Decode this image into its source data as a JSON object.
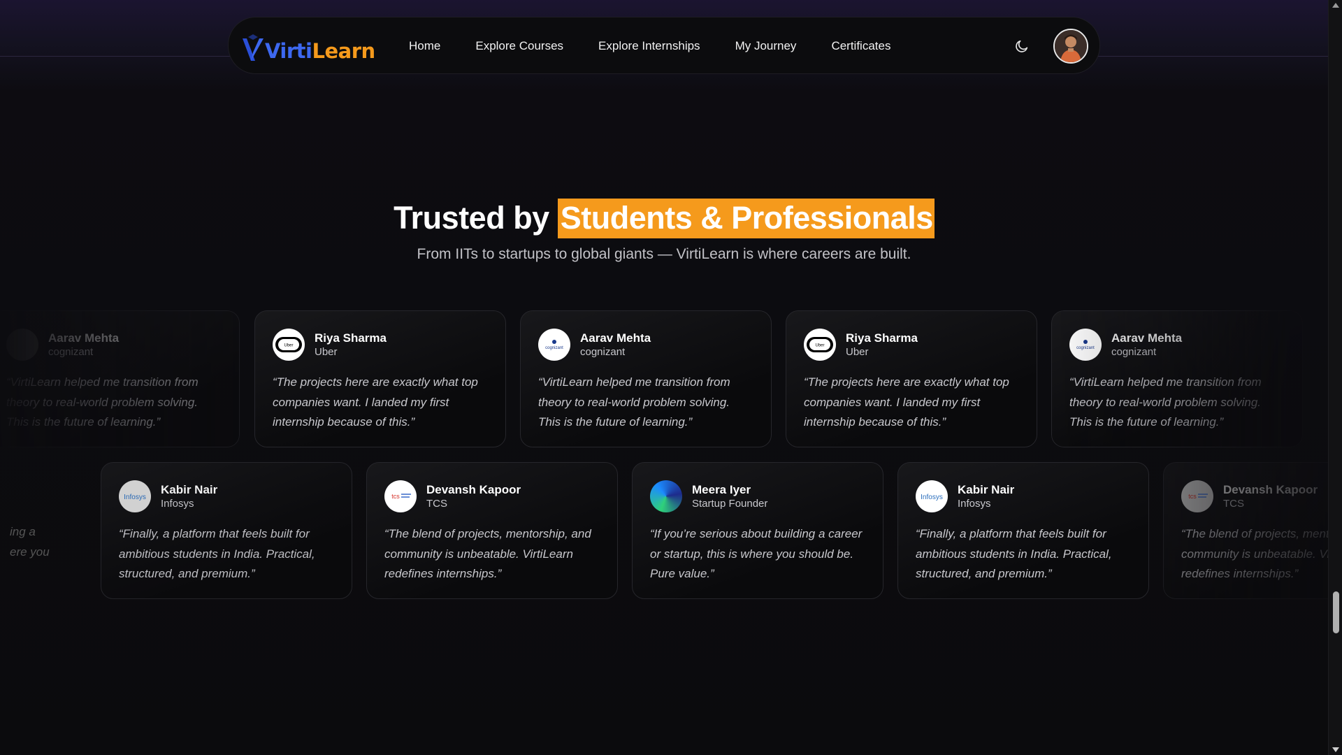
{
  "nav": {
    "logo_text_a": "Virti",
    "logo_text_b": "Learn",
    "items": [
      "Home",
      "Explore Courses",
      "Explore Internships",
      "My Journey",
      "Certificates"
    ],
    "theme_icon": "moon-icon",
    "avatar": "user-avatar"
  },
  "hero": {
    "title_plain": "Trusted by ",
    "title_highlight": "Students & Professionals",
    "subtitle": "From IITs to startups to global giants — VirtiLearn is where careers are built."
  },
  "testimonials_row1": [
    {
      "name": "Aarav Mehta",
      "company": "cognizant",
      "logo": "cognizant-logo",
      "quote": "“VirtiLearn helped me transition from theory to real-world problem solving. This is the future of learning.”"
    },
    {
      "name": "Riya Sharma",
      "company": "Uber",
      "logo": "uber-logo",
      "quote": "“The projects here are exactly what top companies want. I landed my first internship because of this.”"
    },
    {
      "name": "Aarav Mehta",
      "company": "cognizant",
      "logo": "cognizant-logo",
      "quote": "“VirtiLearn helped me transition from theory to real-world problem solving. This is the future of learning.”"
    },
    {
      "name": "Riya Sharma",
      "company": "Uber",
      "logo": "uber-logo",
      "quote": "“The projects here are exactly what top companies want. I landed my first internship because of this.”"
    },
    {
      "name": "Aarav Mehta",
      "company": "cognizant",
      "logo": "cognizant-logo",
      "quote": "“VirtiLearn helped me transition from theory to real-world problem solving. This is the future of learning.”"
    }
  ],
  "testimonials_row2": [
    {
      "name": "Kabir Nair",
      "company": "Infosys",
      "logo": "infosys-logo",
      "quote": "“Finally, a platform that feels built for ambitious students in India. Practical, structured, and premium.”"
    },
    {
      "name": "Devansh Kapoor",
      "company": "TCS",
      "logo": "tcs-logo",
      "quote": "“The blend of projects, mentorship, and community is unbeatable. VirtiLearn redefines internships.”"
    },
    {
      "name": "Meera Iyer",
      "company": "Startup Founder",
      "logo": "gradient-orb-logo",
      "quote": "“If you’re serious about building a career or startup, this is where you should be. Pure value.”"
    },
    {
      "name": "Kabir Nair",
      "company": "Infosys",
      "logo": "infosys-logo",
      "quote": "“Finally, a platform that feels built for ambitious students in India. Practical, structured, and premium.”"
    },
    {
      "name": "Devansh Kapoor",
      "company": "TCS",
      "logo": "tcs-logo",
      "quote": "“The blend of projects, mentorship, and community is unbeatable. VirtiLearn redefines internships.”"
    }
  ],
  "row2_partial_left_quote": "ing a\nere you",
  "logo_labels": {
    "uber": "Uber",
    "cognizant": "cognizant",
    "infosys": "Infosys",
    "tcs": "tcs"
  },
  "colors": {
    "accent": "#f59a1c",
    "brand_blue": "#3d68f0",
    "bg": "#0b0b0d"
  }
}
